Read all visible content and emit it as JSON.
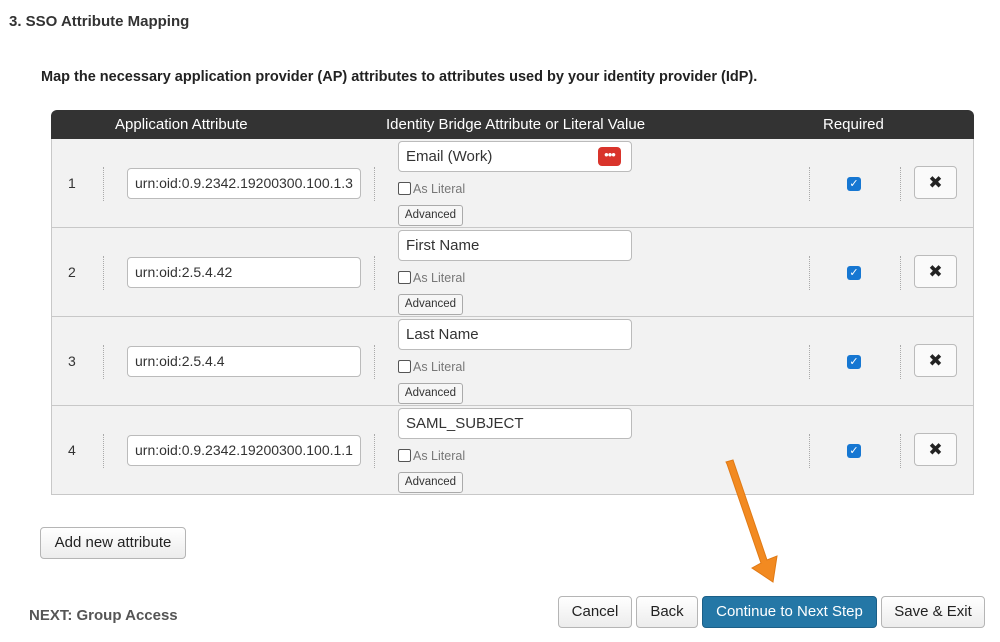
{
  "section": {
    "title": "3. SSO Attribute Mapping"
  },
  "instructions": "Map the necessary application provider (AP) attributes to attributes used by your identity provider (IdP).",
  "table": {
    "headers": {
      "application_attribute": "Application Attribute",
      "identity_bridge": "Identity Bridge Attribute or Literal Value",
      "required": "Required"
    },
    "rows": [
      {
        "num": "1",
        "app_attr": "urn:oid:0.9.2342.19200300.100.1.3",
        "idb_value": "Email (Work)",
        "as_literal_label": "As Literal",
        "as_literal": false,
        "advanced_label": "Advanced",
        "required": true,
        "delete_glyph": "✖"
      },
      {
        "num": "2",
        "app_attr": "urn:oid:2.5.4.42",
        "idb_value": "First Name",
        "as_literal_label": "As Literal",
        "as_literal": false,
        "advanced_label": "Advanced",
        "required": true,
        "delete_glyph": "✖"
      },
      {
        "num": "3",
        "app_attr": "urn:oid:2.5.4.4",
        "idb_value": "Last Name",
        "as_literal_label": "As Literal",
        "as_literal": false,
        "advanced_label": "Advanced",
        "required": true,
        "delete_glyph": "✖"
      },
      {
        "num": "4",
        "app_attr": "urn:oid:0.9.2342.19200300.100.1.1",
        "idb_value": "SAML_SUBJECT",
        "as_literal_label": "As Literal",
        "as_literal": false,
        "advanced_label": "Advanced",
        "required": true,
        "delete_glyph": "✖"
      }
    ]
  },
  "actions": {
    "add_new_attribute": "Add new attribute",
    "cancel": "Cancel",
    "back": "Back",
    "continue": "Continue to Next Step",
    "save_exit": "Save & Exit"
  },
  "next": {
    "label": "NEXT: Group Access"
  },
  "icons": {
    "password_manager": "dots-icon",
    "delete": "close-icon",
    "checkbox_checked": "checkmark-icon",
    "annotation": "orange-arrow-icon"
  },
  "colors": {
    "header_bg": "#333333",
    "primary_button": "#2477a6",
    "checkbox": "#1677d2",
    "annotation_arrow": "#f28a21",
    "dots_icon": "#d9342b"
  }
}
